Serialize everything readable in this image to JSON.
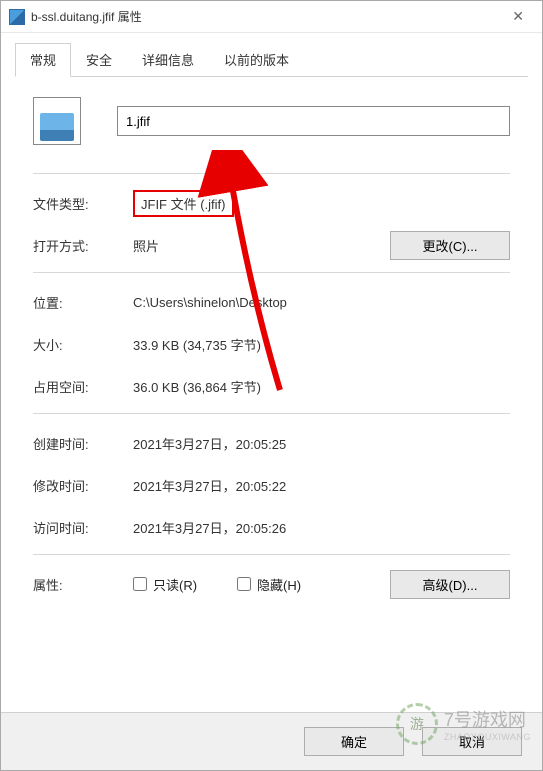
{
  "titlebar": {
    "text": "b-ssl.duitang.jfif 属性"
  },
  "tabs": {
    "general": "常规",
    "security": "安全",
    "details": "详细信息",
    "previous": "以前的版本"
  },
  "filename": "1.jfif",
  "rows": {
    "type_label": "文件类型:",
    "type_value": "JFIF 文件 (.jfif)",
    "open_label": "打开方式:",
    "open_value": "照片",
    "change_btn": "更改(C)...",
    "location_label": "位置:",
    "location_value": "C:\\Users\\shinelon\\Desktop",
    "size_label": "大小:",
    "size_value": "33.9 KB (34,735 字节)",
    "ondisk_label": "占用空间:",
    "ondisk_value": "36.0 KB (36,864 字节)",
    "created_label": "创建时间:",
    "created_value": "2021年3月27日，20:05:25",
    "modified_label": "修改时间:",
    "modified_value": "2021年3月27日，20:05:22",
    "accessed_label": "访问时间:",
    "accessed_value": "2021年3月27日，20:05:26",
    "attr_label": "属性:",
    "readonly": "只读(R)",
    "hidden": "隐藏(H)",
    "advanced_btn": "高级(D)..."
  },
  "buttons": {
    "ok": "确定",
    "cancel": "取消"
  },
  "watermark": {
    "main": "7号游戏网",
    "sub": "ZHAOYOUXIWANG"
  }
}
